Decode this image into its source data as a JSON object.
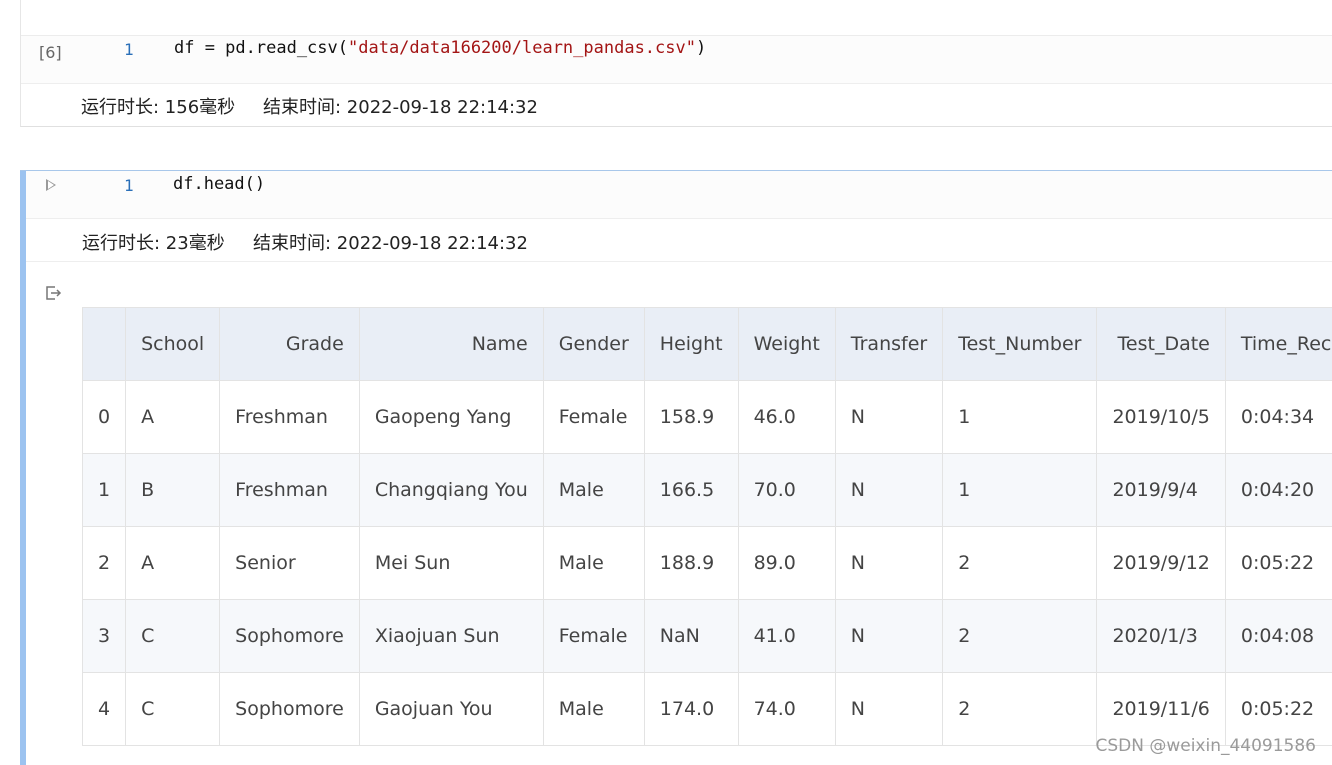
{
  "cell1": {
    "exec_count": "[6]",
    "line_number": "1",
    "code_prefix": "df = pd.read_csv(",
    "code_string": "\"data/data166200/learn_pandas.csv\"",
    "code_suffix": ")",
    "runtime": "运行时长: 156毫秒",
    "end_time": "结束时间: 2022-09-18 22:14:32"
  },
  "cell2": {
    "run_icon": "play-icon",
    "line_number": "1",
    "code": "df.head()",
    "runtime": "运行时长: 23毫秒",
    "end_time": "结束时间: 2022-09-18 22:14:32",
    "output_icon": "output-arrow-icon"
  },
  "table": {
    "columns": [
      "",
      "School",
      "Grade",
      "Name",
      "Gender",
      "Height",
      "Weight",
      "Transfer",
      "Test_Number",
      "Test_Date",
      "Time_Record"
    ],
    "rows": [
      [
        "0",
        "A",
        "Freshman",
        "Gaopeng Yang",
        "Female",
        "158.9",
        "46.0",
        "N",
        "1",
        "2019/10/5",
        "0:04:34"
      ],
      [
        "1",
        "B",
        "Freshman",
        "Changqiang You",
        "Male",
        "166.5",
        "70.0",
        "N",
        "1",
        "2019/9/4",
        "0:04:20"
      ],
      [
        "2",
        "A",
        "Senior",
        "Mei Sun",
        "Male",
        "188.9",
        "89.0",
        "N",
        "2",
        "2019/9/12",
        "0:05:22"
      ],
      [
        "3",
        "C",
        "Sophomore",
        "Xiaojuan Sun",
        "Female",
        "NaN",
        "41.0",
        "N",
        "2",
        "2020/1/3",
        "0:04:08"
      ],
      [
        "4",
        "C",
        "Sophomore",
        "Gaojuan You",
        "Male",
        "174.0",
        "74.0",
        "N",
        "2",
        "2019/11/6",
        "0:05:22"
      ]
    ]
  },
  "watermark": "CSDN @weixin_44091586"
}
